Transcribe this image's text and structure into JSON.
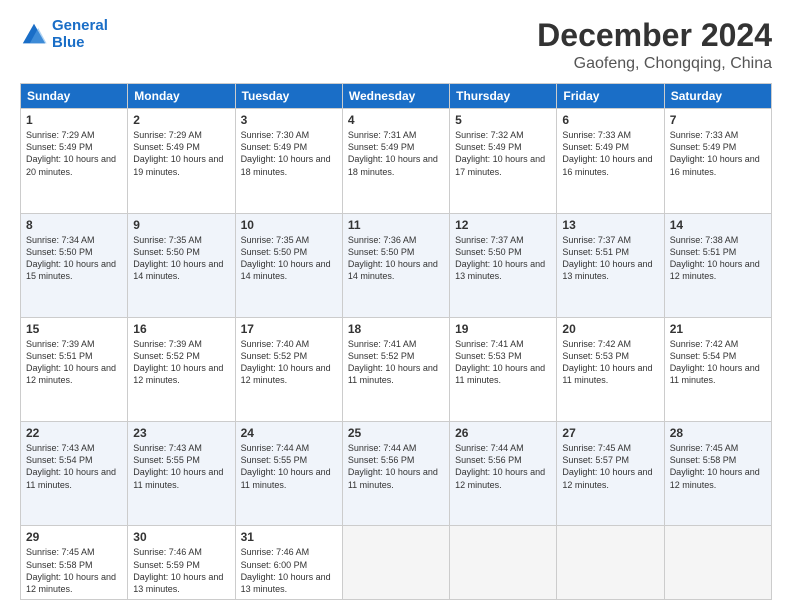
{
  "logo": {
    "line1": "General",
    "line2": "Blue"
  },
  "title": "December 2024",
  "subtitle": "Gaofeng, Chongqing, China",
  "weekdays": [
    "Sunday",
    "Monday",
    "Tuesday",
    "Wednesday",
    "Thursday",
    "Friday",
    "Saturday"
  ],
  "weeks": [
    [
      {
        "day": "1",
        "rise": "7:29 AM",
        "set": "5:49 PM",
        "daylight": "10 hours and 20 minutes."
      },
      {
        "day": "2",
        "rise": "7:29 AM",
        "set": "5:49 PM",
        "daylight": "10 hours and 19 minutes."
      },
      {
        "day": "3",
        "rise": "7:30 AM",
        "set": "5:49 PM",
        "daylight": "10 hours and 18 minutes."
      },
      {
        "day": "4",
        "rise": "7:31 AM",
        "set": "5:49 PM",
        "daylight": "10 hours and 18 minutes."
      },
      {
        "day": "5",
        "rise": "7:32 AM",
        "set": "5:49 PM",
        "daylight": "10 hours and 17 minutes."
      },
      {
        "day": "6",
        "rise": "7:33 AM",
        "set": "5:49 PM",
        "daylight": "10 hours and 16 minutes."
      },
      {
        "day": "7",
        "rise": "7:33 AM",
        "set": "5:49 PM",
        "daylight": "10 hours and 16 minutes."
      }
    ],
    [
      {
        "day": "8",
        "rise": "7:34 AM",
        "set": "5:50 PM",
        "daylight": "10 hours and 15 minutes."
      },
      {
        "day": "9",
        "rise": "7:35 AM",
        "set": "5:50 PM",
        "daylight": "10 hours and 14 minutes."
      },
      {
        "day": "10",
        "rise": "7:35 AM",
        "set": "5:50 PM",
        "daylight": "10 hours and 14 minutes."
      },
      {
        "day": "11",
        "rise": "7:36 AM",
        "set": "5:50 PM",
        "daylight": "10 hours and 14 minutes."
      },
      {
        "day": "12",
        "rise": "7:37 AM",
        "set": "5:50 PM",
        "daylight": "10 hours and 13 minutes."
      },
      {
        "day": "13",
        "rise": "7:37 AM",
        "set": "5:51 PM",
        "daylight": "10 hours and 13 minutes."
      },
      {
        "day": "14",
        "rise": "7:38 AM",
        "set": "5:51 PM",
        "daylight": "10 hours and 12 minutes."
      }
    ],
    [
      {
        "day": "15",
        "rise": "7:39 AM",
        "set": "5:51 PM",
        "daylight": "10 hours and 12 minutes."
      },
      {
        "day": "16",
        "rise": "7:39 AM",
        "set": "5:52 PM",
        "daylight": "10 hours and 12 minutes."
      },
      {
        "day": "17",
        "rise": "7:40 AM",
        "set": "5:52 PM",
        "daylight": "10 hours and 12 minutes."
      },
      {
        "day": "18",
        "rise": "7:41 AM",
        "set": "5:52 PM",
        "daylight": "10 hours and 11 minutes."
      },
      {
        "day": "19",
        "rise": "7:41 AM",
        "set": "5:53 PM",
        "daylight": "10 hours and 11 minutes."
      },
      {
        "day": "20",
        "rise": "7:42 AM",
        "set": "5:53 PM",
        "daylight": "10 hours and 11 minutes."
      },
      {
        "day": "21",
        "rise": "7:42 AM",
        "set": "5:54 PM",
        "daylight": "10 hours and 11 minutes."
      }
    ],
    [
      {
        "day": "22",
        "rise": "7:43 AM",
        "set": "5:54 PM",
        "daylight": "10 hours and 11 minutes."
      },
      {
        "day": "23",
        "rise": "7:43 AM",
        "set": "5:55 PM",
        "daylight": "10 hours and 11 minutes."
      },
      {
        "day": "24",
        "rise": "7:44 AM",
        "set": "5:55 PM",
        "daylight": "10 hours and 11 minutes."
      },
      {
        "day": "25",
        "rise": "7:44 AM",
        "set": "5:56 PM",
        "daylight": "10 hours and 11 minutes."
      },
      {
        "day": "26",
        "rise": "7:44 AM",
        "set": "5:56 PM",
        "daylight": "10 hours and 12 minutes."
      },
      {
        "day": "27",
        "rise": "7:45 AM",
        "set": "5:57 PM",
        "daylight": "10 hours and 12 minutes."
      },
      {
        "day": "28",
        "rise": "7:45 AM",
        "set": "5:58 PM",
        "daylight": "10 hours and 12 minutes."
      }
    ],
    [
      {
        "day": "29",
        "rise": "7:45 AM",
        "set": "5:58 PM",
        "daylight": "10 hours and 12 minutes."
      },
      {
        "day": "30",
        "rise": "7:46 AM",
        "set": "5:59 PM",
        "daylight": "10 hours and 13 minutes."
      },
      {
        "day": "31",
        "rise": "7:46 AM",
        "set": "6:00 PM",
        "daylight": "10 hours and 13 minutes."
      },
      null,
      null,
      null,
      null
    ]
  ]
}
